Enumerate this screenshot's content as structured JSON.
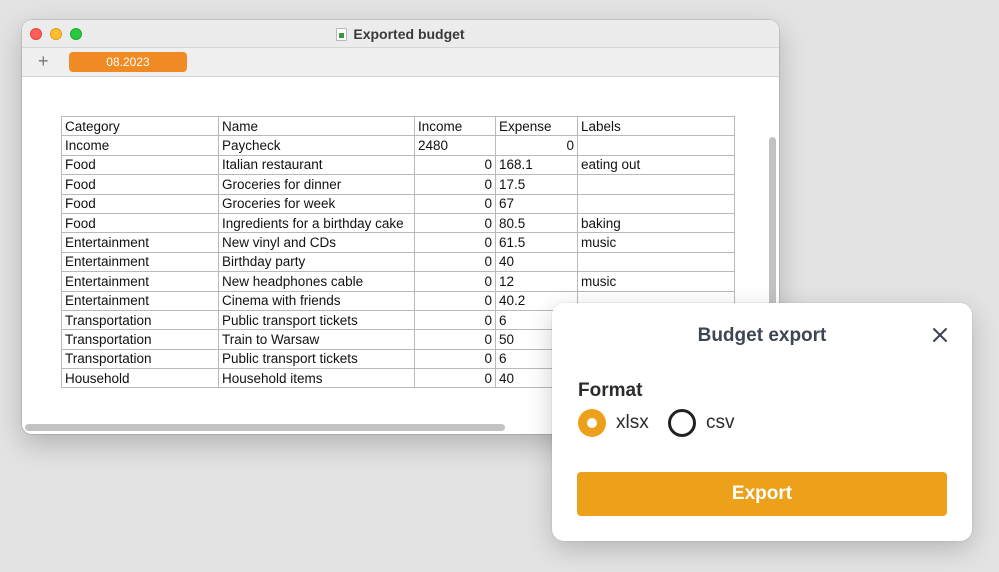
{
  "window": {
    "title": "Exported budget",
    "add_sheet": "+",
    "sheet_tab": "08.2023"
  },
  "table": {
    "headers": [
      "Category",
      "Name",
      "Income",
      "Expense",
      "Labels"
    ],
    "rows": [
      [
        "Income",
        "Paycheck",
        "2480",
        "0",
        ""
      ],
      [
        "Food",
        "Italian restaurant",
        "0",
        "168.1",
        "eating out"
      ],
      [
        "Food",
        "Groceries for dinner",
        "0",
        "17.5",
        ""
      ],
      [
        "Food",
        "Groceries for week",
        "0",
        "67",
        ""
      ],
      [
        "Food",
        "Ingredients for a birthday cake",
        "0",
        "80.5",
        "baking"
      ],
      [
        "Entertainment",
        "New vinyl and CDs",
        "0",
        "61.5",
        "music"
      ],
      [
        "Entertainment",
        "Birthday party",
        "0",
        "40",
        ""
      ],
      [
        "Entertainment",
        "New headphones cable",
        "0",
        "12",
        "music"
      ],
      [
        "Entertainment",
        "Cinema with friends",
        "0",
        "40.2",
        ""
      ],
      [
        "Transportation",
        "Public transport tickets",
        "0",
        "6",
        ""
      ],
      [
        "Transportation",
        "Train to Warsaw",
        "0",
        "50",
        ""
      ],
      [
        "Transportation",
        "Public transport tickets",
        "0",
        "6",
        ""
      ],
      [
        "Household",
        "Household items",
        "0",
        "40",
        ""
      ]
    ]
  },
  "dialog": {
    "title": "Budget export",
    "format_label": "Format",
    "options": [
      {
        "label": "xlsx",
        "selected": true
      },
      {
        "label": "csv",
        "selected": false
      }
    ],
    "export_label": "Export",
    "accent_color": "#eda11a"
  }
}
